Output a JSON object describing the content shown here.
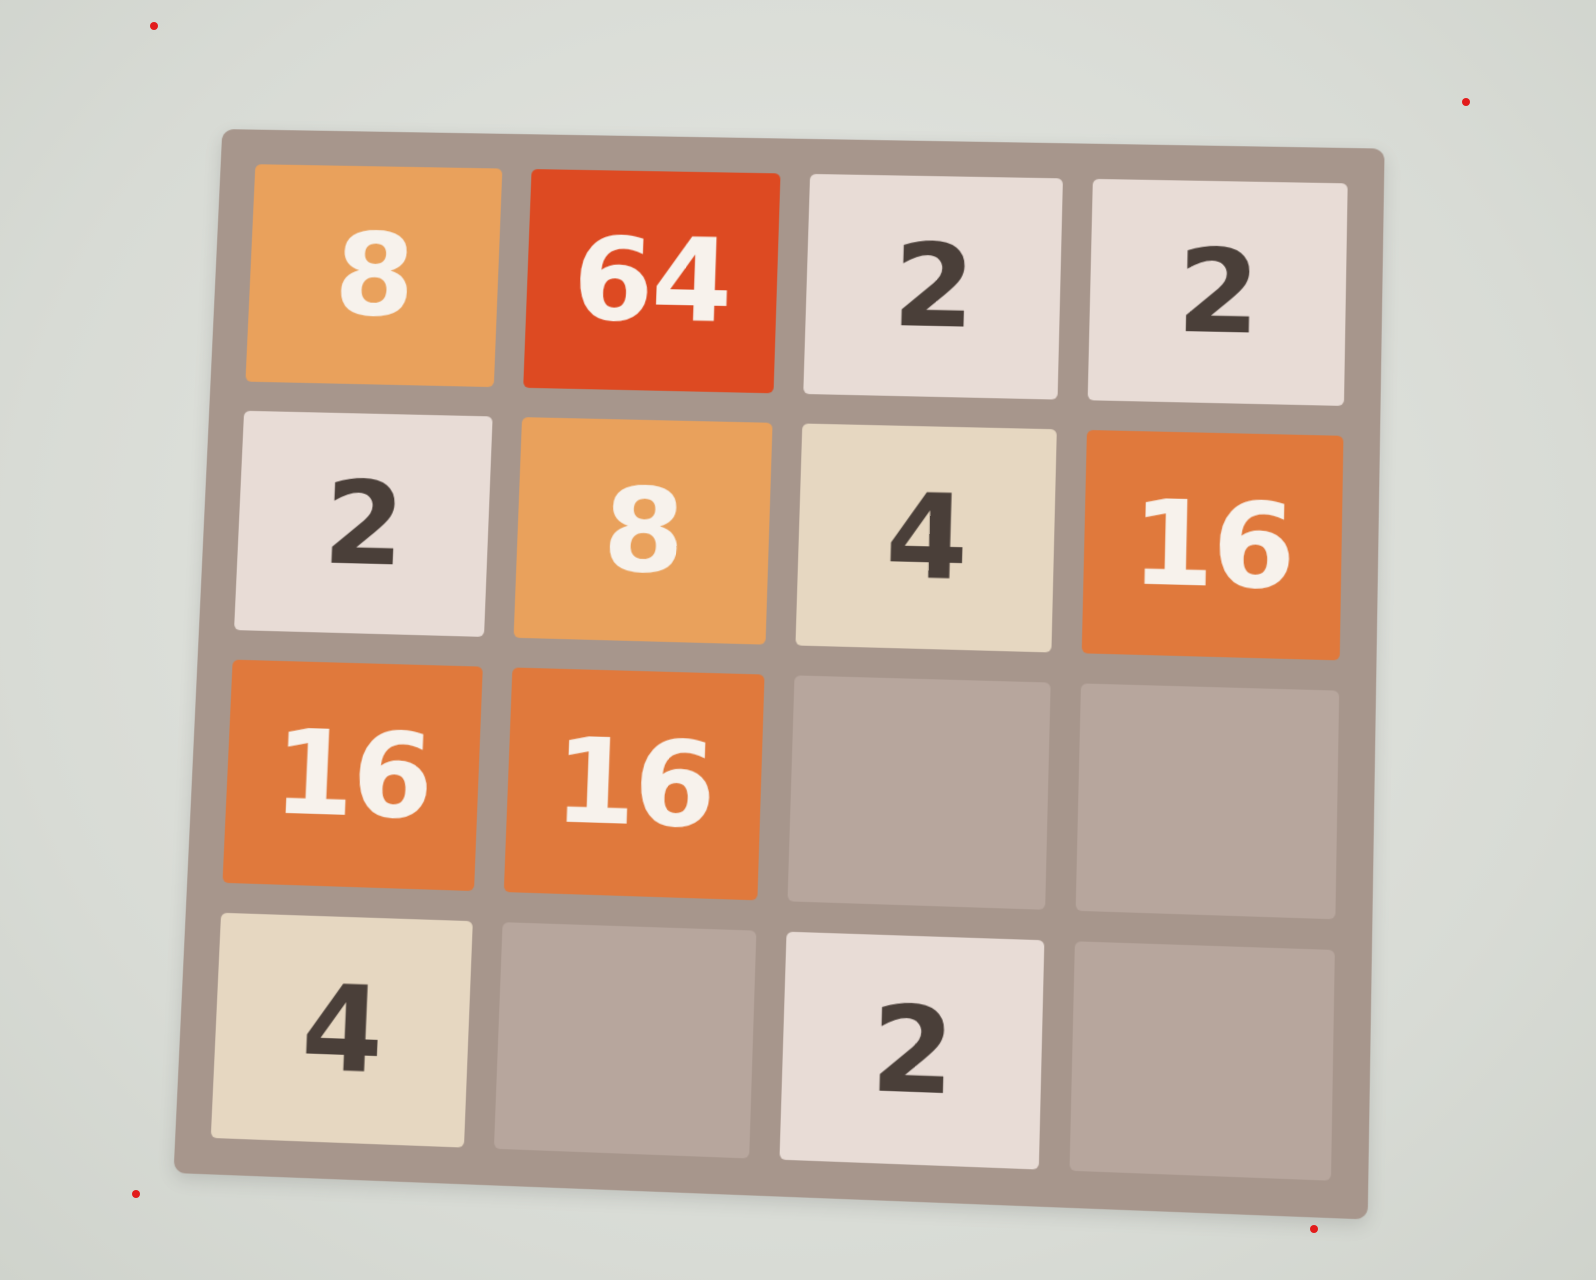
{
  "game": {
    "name": "",
    "grid": [
      [
        8,
        64,
        2,
        2
      ],
      [
        2,
        8,
        4,
        16
      ],
      [
        16,
        16,
        null,
        null
      ],
      [
        4,
        null,
        2,
        null
      ]
    ],
    "tile_colors": {
      "empty": "#b7a69d",
      "2": "#e8dcd6",
      "4": "#e6d7c1",
      "8": "#e9a15c",
      "16": "#e0793c",
      "64": "#dd4a22"
    },
    "board_color": "#a7968c"
  }
}
